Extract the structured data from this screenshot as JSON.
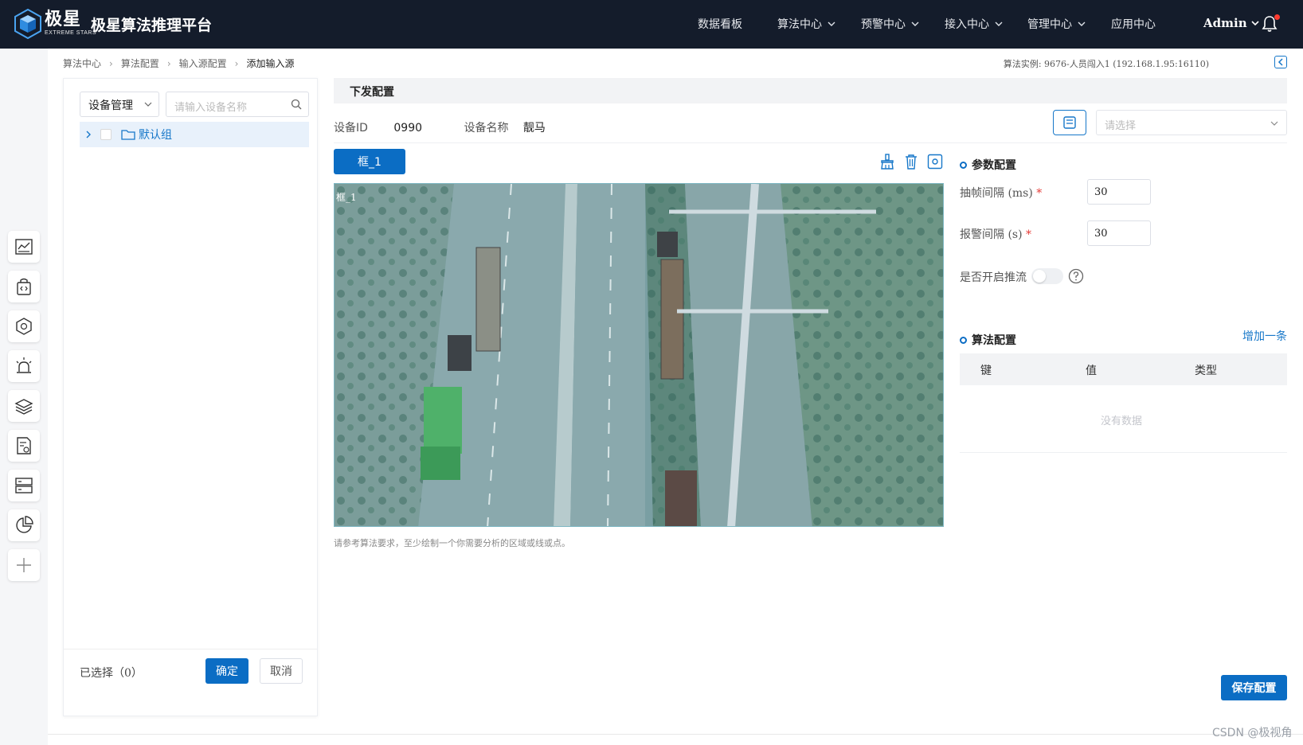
{
  "header": {
    "logo_cn": "极星",
    "logo_en": "EXTREME STARS",
    "platform_title": "极星算法推理平台",
    "nav": [
      {
        "label": "数据看板",
        "dropdown": false
      },
      {
        "label": "算法中心",
        "dropdown": true
      },
      {
        "label": "预警中心",
        "dropdown": true
      },
      {
        "label": "接入中心",
        "dropdown": true
      },
      {
        "label": "管理中心",
        "dropdown": true
      },
      {
        "label": "应用中心",
        "dropdown": false
      }
    ],
    "user": "Admin",
    "notification_dot": "#ff3b30",
    "bg_color": "#141c2b"
  },
  "rail": {
    "icons": [
      "dashboard-chart-icon",
      "code-bag-icon",
      "model-cube-icon",
      "alarm-light-icon",
      "layers-icon",
      "document-settings-icon",
      "server-icon",
      "pie-chart-icon",
      "plus-icon"
    ]
  },
  "breadcrumb": [
    "算法中心",
    "算法配置",
    "输入源配置",
    "添加输入源"
  ],
  "instance_text": "算法实例: 9676-人员闯入1 (192.168.1.95:16110)",
  "left_panel": {
    "device_select": "设备管理",
    "search_placeholder": "请输入设备名称",
    "tree_item": "默认组",
    "selected_text": "已选择（0）",
    "ok_label": "确定",
    "cancel_label": "取消"
  },
  "main": {
    "section_title": "下发配置",
    "device_id_label": "设备ID",
    "device_id_value": "0990",
    "device_name_label": "设备名称",
    "device_name_value": "靓马",
    "pick_placeholder": "请选择",
    "frame_tab": "框_1",
    "canvas_label": "框_1",
    "hint": "请参考算法要求，至少绘制一个你需要分析的区域或线或点。"
  },
  "params": {
    "title": "参数配置",
    "fields": [
      {
        "label": "抽帧间隔 (ms)",
        "value": "30"
      },
      {
        "label": "报警间隔 (s)",
        "value": "30"
      }
    ],
    "stream_label": "是否开启推流",
    "stream_on": false
  },
  "algo": {
    "title": "算法配置",
    "add_label": "增加一条",
    "columns": [
      "键",
      "值",
      "类型"
    ],
    "empty_text": "没有数据"
  },
  "save_label": "保存配置",
  "watermark": "CSDN @极视角",
  "accent_color": "#0b6dc4"
}
